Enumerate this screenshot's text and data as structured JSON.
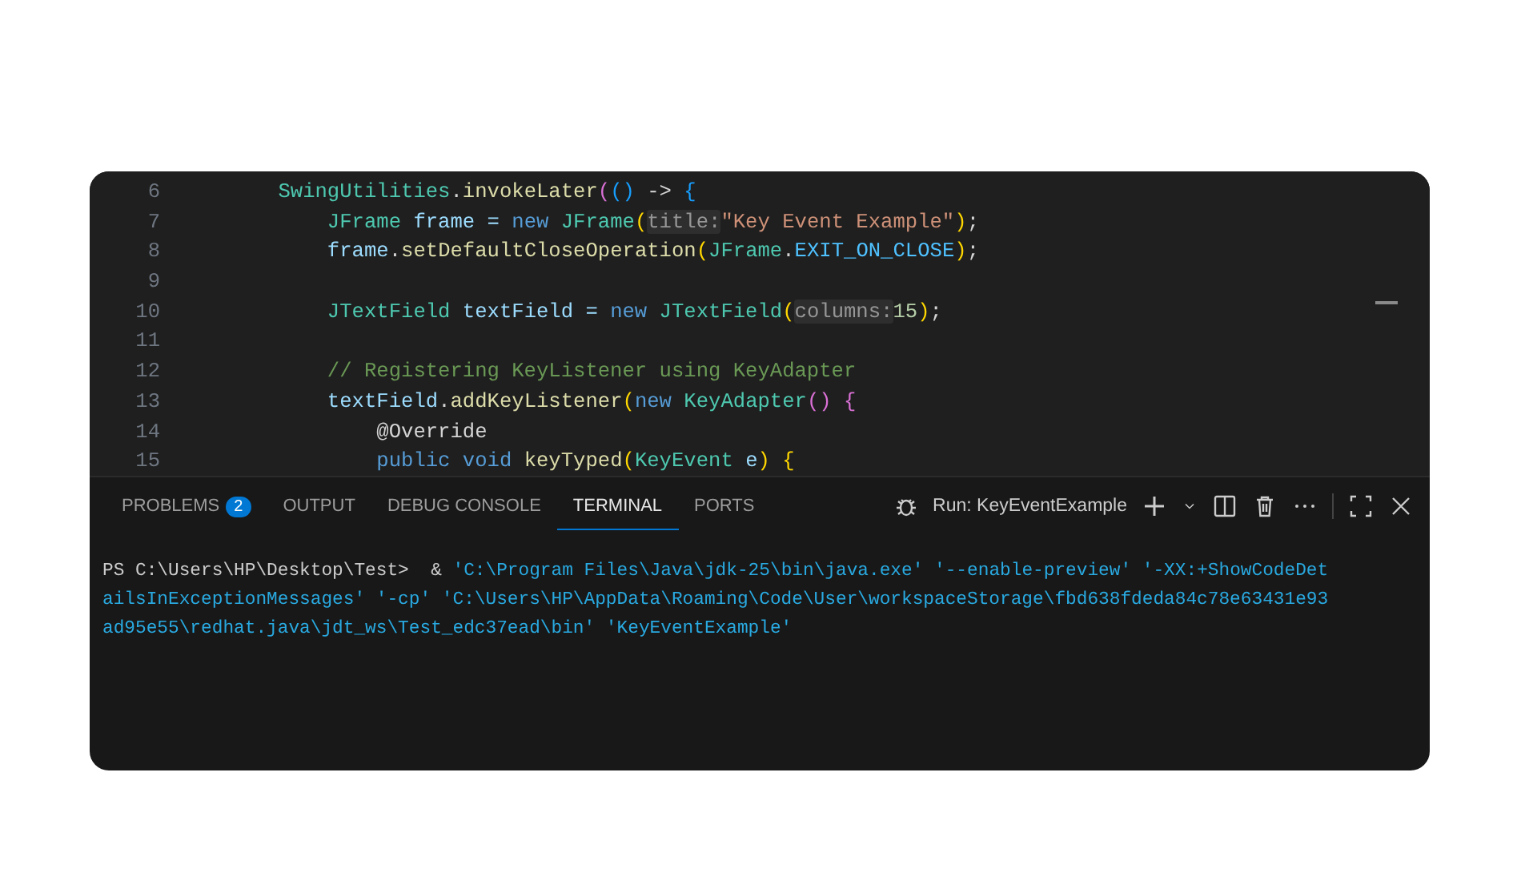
{
  "editor": {
    "lines": [
      {
        "number": "6",
        "tokens": [
          {
            "t": "    SwingUtilities",
            "color": "#4ec9b0"
          },
          {
            "t": ".",
            "color": "#d4d4d4"
          },
          {
            "t": "invokeLater",
            "color": "#dcdcaa"
          },
          {
            "t": "(",
            "color": "#da70d6"
          },
          {
            "t": "()",
            "color": "#179fff"
          },
          {
            "t": " -> ",
            "color": "#d4d4d4"
          },
          {
            "t": "{",
            "color": "#179fff"
          }
        ]
      },
      {
        "number": "7",
        "tokens": [
          {
            "t": "        JFrame ",
            "color": "#4ec9b0"
          },
          {
            "t": "frame = ",
            "color": "#9cdcfe"
          },
          {
            "t": "new ",
            "color": "#569cd6"
          },
          {
            "t": "JFrame",
            "color": "#4ec9b0"
          },
          {
            "t": "(",
            "color": "#ffd700"
          },
          {
            "t": "title:",
            "color": "#969696",
            "hint": true
          },
          {
            "t": "\"Key Event Example\"",
            "color": "#ce9178"
          },
          {
            "t": ")",
            "color": "#ffd700"
          },
          {
            "t": ";",
            "color": "#d4d4d4"
          }
        ]
      },
      {
        "number": "8",
        "tokens": [
          {
            "t": "        frame",
            "color": "#9cdcfe"
          },
          {
            "t": ".",
            "color": "#d4d4d4"
          },
          {
            "t": "setDefaultCloseOperation",
            "color": "#dcdcaa"
          },
          {
            "t": "(",
            "color": "#ffd700"
          },
          {
            "t": "JFrame",
            "color": "#4ec9b0"
          },
          {
            "t": ".",
            "color": "#d4d4d4"
          },
          {
            "t": "EXIT_ON_CLOSE",
            "color": "#4fc1ff"
          },
          {
            "t": ")",
            "color": "#ffd700"
          },
          {
            "t": ";",
            "color": "#d4d4d4"
          }
        ]
      },
      {
        "number": "9"
      },
      {
        "number": "10",
        "tokens": [
          {
            "t": "        JTextField ",
            "color": "#4ec9b0"
          },
          {
            "t": "textField = ",
            "color": "#9cdcfe"
          },
          {
            "t": "new ",
            "color": "#569cd6"
          },
          {
            "t": "JTextField",
            "color": "#4ec9b0"
          },
          {
            "t": "(",
            "color": "#ffd700"
          },
          {
            "t": "columns:",
            "color": "#969696",
            "hint": true
          },
          {
            "t": "15",
            "color": "#b5cea8"
          },
          {
            "t": ")",
            "color": "#ffd700"
          },
          {
            "t": ";",
            "color": "#d4d4d4"
          }
        ]
      },
      {
        "number": "11"
      },
      {
        "number": "12",
        "tokens": [
          {
            "t": "        // Registering KeyListener using KeyAdapter",
            "color": "#6a9955"
          }
        ]
      },
      {
        "number": "13",
        "tokens": [
          {
            "t": "        textField",
            "color": "#9cdcfe"
          },
          {
            "t": ".",
            "color": "#d4d4d4"
          },
          {
            "t": "addKeyListener",
            "color": "#dcdcaa"
          },
          {
            "t": "(",
            "color": "#ffd700"
          },
          {
            "t": "new ",
            "color": "#569cd6"
          },
          {
            "t": "KeyAdapter",
            "color": "#4ec9b0"
          },
          {
            "t": "() {",
            "color": "#da70d6"
          }
        ]
      },
      {
        "number": "14",
        "tokens": [
          {
            "t": "            @Override",
            "color": "#d4d4d4"
          }
        ]
      },
      {
        "number": "15",
        "tokens": [
          {
            "t": "            public void ",
            "color": "#569cd6"
          },
          {
            "t": "keyTyped",
            "color": "#dcdcaa"
          },
          {
            "t": "(",
            "color": "#ffd700"
          },
          {
            "t": "KeyEvent ",
            "color": "#4ec9b0"
          },
          {
            "t": "e",
            "color": "#9cdcfe"
          },
          {
            "t": ") {",
            "color": "#ffd700"
          }
        ]
      }
    ]
  },
  "panel": {
    "tabs": [
      {
        "label": "PROBLEMS",
        "badge": "2",
        "selected": false
      },
      {
        "label": "OUTPUT",
        "selected": false
      },
      {
        "label": "DEBUG CONSOLE",
        "selected": false
      },
      {
        "label": "TERMINAL",
        "selected": true
      },
      {
        "label": "PORTS",
        "selected": false
      }
    ],
    "terminal_name": "Run: KeyEventExample"
  },
  "terminal": {
    "lines": [
      [
        {
          "t": "PS C:\\Users\\HP\\Desktop\\Test>  & ",
          "color": "#cccccc"
        },
        {
          "t": "'C:\\Program Files\\Java\\jdk-25\\bin\\java.exe' '--enable-preview' '-XX:+ShowCodeDet",
          "color": "#29a9e0"
        }
      ],
      [
        {
          "t": "ailsInExceptionMessages' '-cp' 'C:\\Users\\HP\\AppData\\Roaming\\Code\\User\\workspaceStorage\\fbd638fdeda84c78e63431e93",
          "color": "#29a9e0"
        }
      ],
      [
        {
          "t": "ad95e55\\redhat.java\\jdt_ws\\Test_edc37ead\\bin' 'KeyEventExample'",
          "color": "#29a9e0"
        }
      ]
    ]
  }
}
